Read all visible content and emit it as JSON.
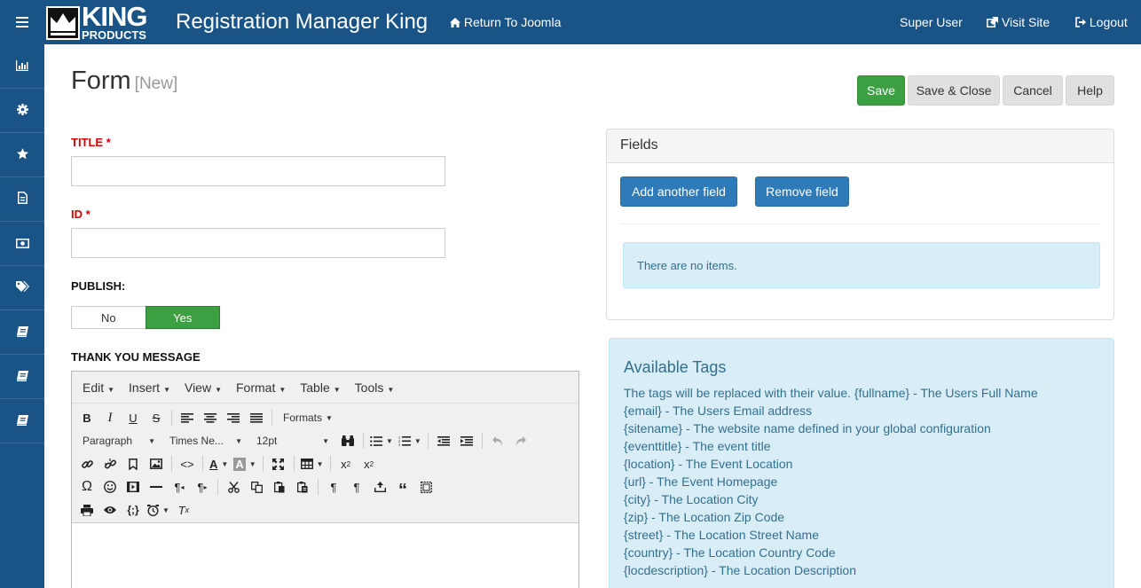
{
  "header": {
    "menu_icon": "bars-icon",
    "logo_top": "KING",
    "logo_bottom": "PRODUCTS",
    "app_title": "Registration Manager King",
    "return_link": "Return To Joomla",
    "user": "Super User",
    "visit_site": "Visit Site",
    "logout": "Logout"
  },
  "sidebar": {
    "items": [
      {
        "icon": "bar-chart-icon"
      },
      {
        "icon": "gear-icon"
      },
      {
        "icon": "star-icon"
      },
      {
        "icon": "file-icon"
      },
      {
        "icon": "money-icon"
      },
      {
        "icon": "tags-icon"
      },
      {
        "icon": "book-icon"
      },
      {
        "icon": "book-icon"
      },
      {
        "icon": "book-icon"
      }
    ]
  },
  "page": {
    "title": "Form",
    "subtitle": "[New]"
  },
  "toolbar": {
    "save": "Save",
    "save_close": "Save & Close",
    "cancel": "Cancel",
    "help": "Help"
  },
  "form": {
    "title_label": "TITLE *",
    "title_value": "",
    "id_label": "ID *",
    "id_value": "",
    "publish_label": "PUBLISH:",
    "publish_no": "No",
    "publish_yes": "Yes",
    "publish_selected": "Yes",
    "thankyou_label": "THANK YOU MESSAGE"
  },
  "editor": {
    "menus": [
      "Edit",
      "Insert",
      "View",
      "Format",
      "Table",
      "Tools"
    ],
    "formats": "Formats",
    "block_format": "Paragraph",
    "font_family": "Times Ne...",
    "font_size": "12pt"
  },
  "fields_panel": {
    "heading": "Fields",
    "add_button": "Add another field",
    "remove_button": "Remove field",
    "empty_message": "There are no items."
  },
  "tags": {
    "title": "Available Tags",
    "lines": [
      "The tags will be replaced with their value. {fullname} - The Users Full Name",
      "{email} - The Users Email address",
      "{sitename} - The website name defined in your global configuration",
      "{eventtitle} - The event title",
      "{location} - The Event Location",
      "{url} - The Event Homepage",
      "{city} - The Location City",
      "{zip} - The Location Zip Code",
      "{street} - The Location Street Name",
      "{country} - The Location Country Code",
      "{locdescription} - The Location Description"
    ]
  },
  "colors": {
    "brand": "#1a5487",
    "success": "#3c9f41",
    "primary": "#2f7ab8",
    "required": "#d20000",
    "info_bg": "#d9edf7",
    "info_text": "#31708f"
  }
}
